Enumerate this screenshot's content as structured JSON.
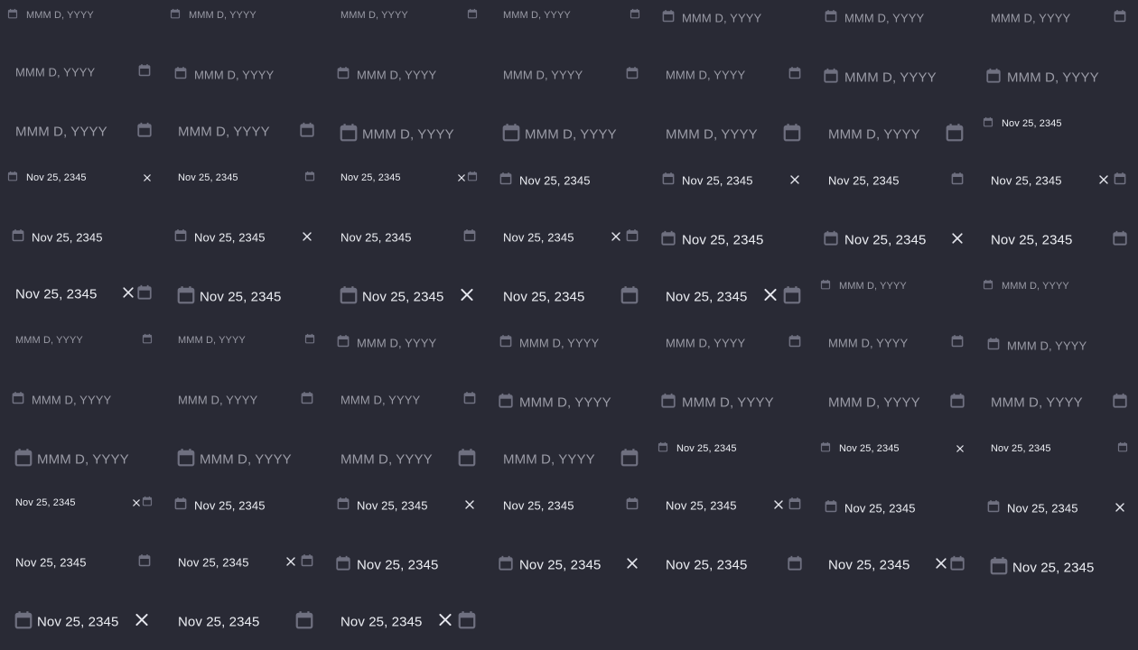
{
  "placeholder": "MMM D, YYYY",
  "value": "Nov 25, 2345",
  "colors": {
    "background": "#292a35",
    "placeholder": "#9a9ba6",
    "value": "#eceef3",
    "calendar_icon": "#6f7080",
    "clear_icon": "#e6e7ee"
  },
  "icons": {
    "calendar": "calendar-icon",
    "clear": "close-icon"
  },
  "items": [
    {
      "filled": false,
      "size": "xs",
      "left": true,
      "clear": false,
      "right": false
    },
    {
      "filled": false,
      "size": "xs",
      "left": true,
      "clear": false,
      "right": false
    },
    {
      "filled": false,
      "size": "xs",
      "left": false,
      "clear": false,
      "right": true
    },
    {
      "filled": false,
      "size": "xs",
      "left": false,
      "clear": false,
      "right": true
    },
    {
      "filled": false,
      "size": "sm",
      "left": true,
      "clear": false,
      "right": false
    },
    {
      "filled": false,
      "size": "sm",
      "left": true,
      "clear": false,
      "right": false
    },
    {
      "filled": false,
      "size": "sm",
      "left": false,
      "clear": false,
      "right": true
    },
    {
      "filled": false,
      "size": "sm",
      "left": false,
      "clear": false,
      "right": true
    },
    {
      "filled": false,
      "size": "sm",
      "left": true,
      "clear": false,
      "right": false
    },
    {
      "filled": false,
      "size": "sm",
      "left": true,
      "clear": false,
      "right": false
    },
    {
      "filled": false,
      "size": "sm",
      "left": false,
      "clear": false,
      "right": true
    },
    {
      "filled": false,
      "size": "sm",
      "left": false,
      "clear": false,
      "right": true
    },
    {
      "filled": false,
      "size": "md",
      "left": true,
      "clear": false,
      "right": false
    },
    {
      "filled": false,
      "size": "md",
      "left": true,
      "clear": false,
      "right": false
    },
    {
      "filled": false,
      "size": "md",
      "left": false,
      "clear": false,
      "right": true
    },
    {
      "filled": false,
      "size": "md",
      "left": false,
      "clear": false,
      "right": true
    },
    {
      "filled": false,
      "size": "lg",
      "left": true,
      "clear": false,
      "right": false
    },
    {
      "filled": false,
      "size": "lg",
      "left": true,
      "clear": false,
      "right": false
    },
    {
      "filled": false,
      "size": "lg",
      "left": false,
      "clear": false,
      "right": true
    },
    {
      "filled": false,
      "size": "lg",
      "left": false,
      "clear": false,
      "right": true
    },
    {
      "filled": true,
      "size": "xs",
      "left": true,
      "clear": false,
      "right": false
    },
    {
      "filled": true,
      "size": "xs",
      "left": true,
      "clear": true,
      "right": false
    },
    {
      "filled": true,
      "size": "xs",
      "left": false,
      "clear": false,
      "right": true
    },
    {
      "filled": true,
      "size": "xs",
      "left": false,
      "clear": true,
      "right": true
    },
    {
      "filled": true,
      "size": "sm",
      "left": true,
      "clear": false,
      "right": false
    },
    {
      "filled": true,
      "size": "sm",
      "left": true,
      "clear": true,
      "right": false
    },
    {
      "filled": true,
      "size": "sm",
      "left": false,
      "clear": false,
      "right": true
    },
    {
      "filled": true,
      "size": "sm",
      "left": false,
      "clear": true,
      "right": true
    },
    {
      "filled": true,
      "size": "sm",
      "left": true,
      "clear": false,
      "right": false
    },
    {
      "filled": true,
      "size": "sm",
      "left": true,
      "clear": true,
      "right": false
    },
    {
      "filled": true,
      "size": "sm",
      "left": false,
      "clear": false,
      "right": true
    },
    {
      "filled": true,
      "size": "sm",
      "left": false,
      "clear": true,
      "right": true
    },
    {
      "filled": true,
      "size": "md",
      "left": true,
      "clear": false,
      "right": false
    },
    {
      "filled": true,
      "size": "md",
      "left": true,
      "clear": true,
      "right": false
    },
    {
      "filled": true,
      "size": "md",
      "left": false,
      "clear": false,
      "right": true
    },
    {
      "filled": true,
      "size": "md",
      "left": false,
      "clear": true,
      "right": true
    },
    {
      "filled": true,
      "size": "lg",
      "left": true,
      "clear": false,
      "right": false
    },
    {
      "filled": true,
      "size": "lg",
      "left": true,
      "clear": true,
      "right": false
    },
    {
      "filled": true,
      "size": "lg",
      "left": false,
      "clear": false,
      "right": true
    },
    {
      "filled": true,
      "size": "lg",
      "left": false,
      "clear": true,
      "right": true
    },
    {
      "filled": false,
      "size": "xs",
      "left": true,
      "clear": false,
      "right": false
    },
    {
      "filled": false,
      "size": "xs",
      "left": true,
      "clear": false,
      "right": false
    },
    {
      "filled": false,
      "size": "xs",
      "left": false,
      "clear": false,
      "right": true
    },
    {
      "filled": false,
      "size": "xs",
      "left": false,
      "clear": false,
      "right": true
    },
    {
      "filled": false,
      "size": "sm",
      "left": true,
      "clear": false,
      "right": false
    },
    {
      "filled": false,
      "size": "sm",
      "left": true,
      "clear": false,
      "right": false
    },
    {
      "filled": false,
      "size": "sm",
      "left": false,
      "clear": false,
      "right": true
    },
    {
      "filled": false,
      "size": "sm",
      "left": false,
      "clear": false,
      "right": true
    },
    {
      "filled": false,
      "size": "sm",
      "left": true,
      "clear": false,
      "right": false
    },
    {
      "filled": false,
      "size": "sm",
      "left": true,
      "clear": false,
      "right": false
    },
    {
      "filled": false,
      "size": "sm",
      "left": false,
      "clear": false,
      "right": true
    },
    {
      "filled": false,
      "size": "sm",
      "left": false,
      "clear": false,
      "right": true
    },
    {
      "filled": false,
      "size": "md",
      "left": true,
      "clear": false,
      "right": false
    },
    {
      "filled": false,
      "size": "md",
      "left": true,
      "clear": false,
      "right": false
    },
    {
      "filled": false,
      "size": "md",
      "left": false,
      "clear": false,
      "right": true
    },
    {
      "filled": false,
      "size": "md",
      "left": false,
      "clear": false,
      "right": true
    },
    {
      "filled": false,
      "size": "lg",
      "left": true,
      "clear": false,
      "right": false
    },
    {
      "filled": false,
      "size": "lg",
      "left": true,
      "clear": false,
      "right": false
    },
    {
      "filled": false,
      "size": "lg",
      "left": false,
      "clear": false,
      "right": true
    },
    {
      "filled": false,
      "size": "lg",
      "left": false,
      "clear": false,
      "right": true
    },
    {
      "filled": true,
      "size": "xs",
      "left": true,
      "clear": false,
      "right": false
    },
    {
      "filled": true,
      "size": "xs",
      "left": true,
      "clear": true,
      "right": false
    },
    {
      "filled": true,
      "size": "xs",
      "left": false,
      "clear": false,
      "right": true
    },
    {
      "filled": true,
      "size": "xs",
      "left": false,
      "clear": true,
      "right": true
    },
    {
      "filled": true,
      "size": "sm",
      "left": true,
      "clear": false,
      "right": false
    },
    {
      "filled": true,
      "size": "sm",
      "left": true,
      "clear": true,
      "right": false
    },
    {
      "filled": true,
      "size": "sm",
      "left": false,
      "clear": false,
      "right": true
    },
    {
      "filled": true,
      "size": "sm",
      "left": false,
      "clear": true,
      "right": true
    },
    {
      "filled": true,
      "size": "sm",
      "left": true,
      "clear": false,
      "right": false
    },
    {
      "filled": true,
      "size": "sm",
      "left": true,
      "clear": true,
      "right": false
    },
    {
      "filled": true,
      "size": "sm",
      "left": false,
      "clear": false,
      "right": true
    },
    {
      "filled": true,
      "size": "sm",
      "left": false,
      "clear": true,
      "right": true
    },
    {
      "filled": true,
      "size": "md",
      "left": true,
      "clear": false,
      "right": false
    },
    {
      "filled": true,
      "size": "md",
      "left": true,
      "clear": true,
      "right": false
    },
    {
      "filled": true,
      "size": "md",
      "left": false,
      "clear": false,
      "right": true
    },
    {
      "filled": true,
      "size": "md",
      "left": false,
      "clear": true,
      "right": true
    },
    {
      "filled": true,
      "size": "lg",
      "left": true,
      "clear": false,
      "right": false
    },
    {
      "filled": true,
      "size": "lg",
      "left": true,
      "clear": true,
      "right": false
    },
    {
      "filled": true,
      "size": "lg",
      "left": false,
      "clear": false,
      "right": true
    },
    {
      "filled": true,
      "size": "lg",
      "left": false,
      "clear": true,
      "right": true
    }
  ]
}
